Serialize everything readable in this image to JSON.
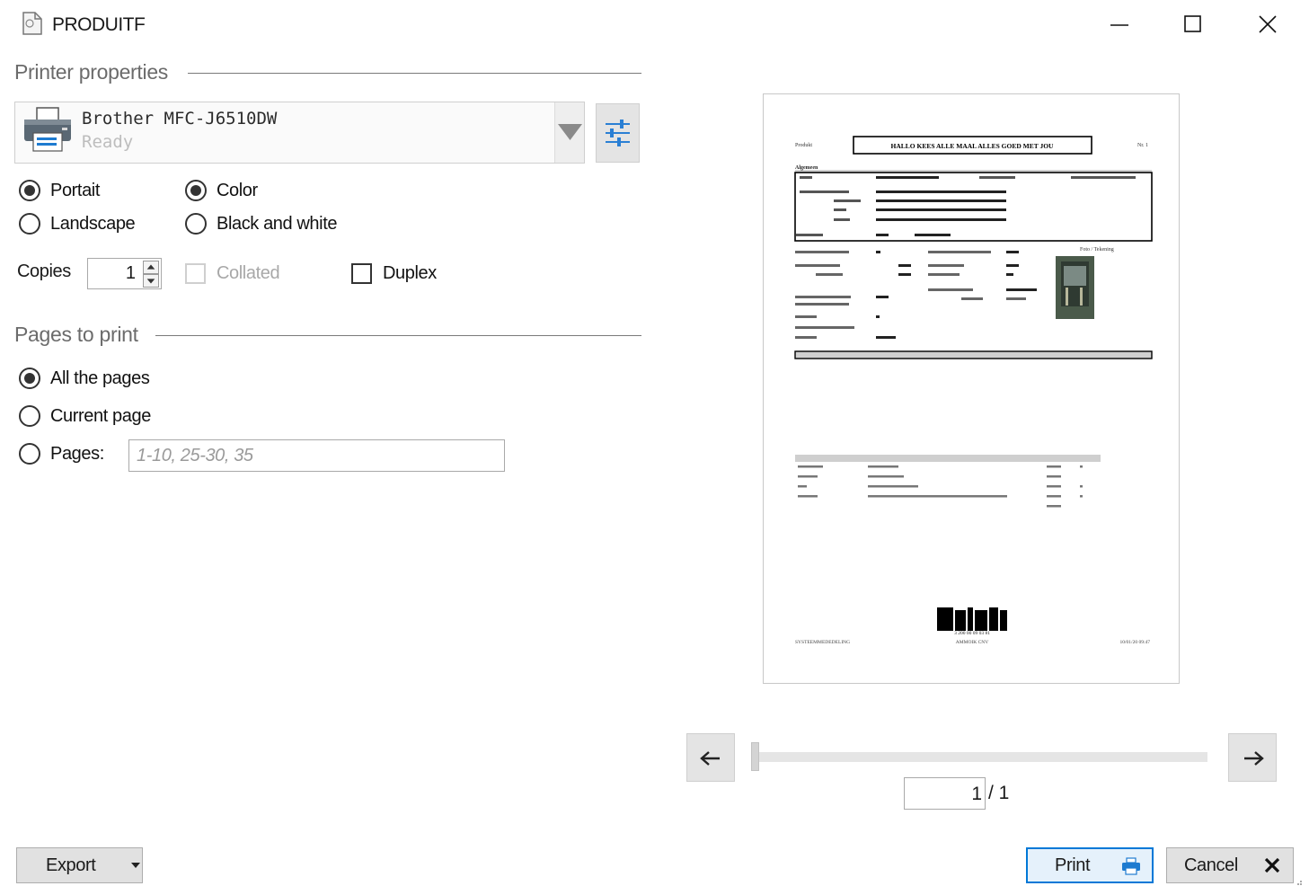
{
  "window": {
    "title": "PRODUITF",
    "controls": [
      "minimize-icon",
      "maximize-icon",
      "close-icon"
    ]
  },
  "printer_properties": {
    "heading": "Printer properties",
    "printer": {
      "name": "Brother MFC-J6510DW",
      "status": "Ready"
    },
    "orientation": {
      "options": [
        {
          "label": "Portait",
          "selected": true
        },
        {
          "label": "Landscape",
          "selected": false
        }
      ]
    },
    "color_mode": {
      "options": [
        {
          "label": "Color",
          "selected": true
        },
        {
          "label": "Black and white",
          "selected": false
        }
      ]
    },
    "copies": {
      "label": "Copies",
      "value": "1"
    },
    "collated": {
      "label": "Collated",
      "checked": false,
      "enabled": false
    },
    "duplex": {
      "label": "Duplex",
      "checked": false
    }
  },
  "pages_to_print": {
    "heading": "Pages to print",
    "options": [
      {
        "label": "All the pages",
        "selected": true
      },
      {
        "label": "Current page",
        "selected": false
      },
      {
        "label": "Pages:",
        "selected": false
      }
    ],
    "pages_placeholder": "1-10, 25-30, 35"
  },
  "preview": {
    "header_left": "Produkt",
    "header_title": "HALLO KEES ALLE MAAL ALLES GOED MET JOU",
    "header_right": "Nr. 1",
    "section_label": "Algemeen",
    "image_label": "Foto / Tekening",
    "footer_left": "SYSTEEMMEDEDELING",
    "footer_center": "AMMOIK CNV",
    "footer_right": "10/01/20  09:47",
    "barcode_text": "3 200 00  09 03 81"
  },
  "navigation": {
    "current_page": "1",
    "total_label": "/ 1",
    "current_fraction": 0.0
  },
  "buttons": {
    "export": "Export",
    "print": "Print",
    "cancel": "Cancel"
  },
  "colors": {
    "accent": "#0078d7",
    "printer_icon": "#1e7bd0"
  }
}
